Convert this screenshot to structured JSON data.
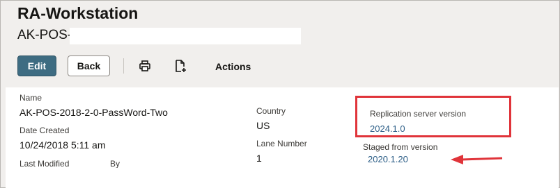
{
  "header": {
    "title": "RA-Workstation",
    "subtitle": "AK-POS-"
  },
  "toolbar": {
    "edit_label": "Edit",
    "back_label": "Back",
    "actions_label": "Actions",
    "icons": [
      "print-icon",
      "new-document-icon"
    ]
  },
  "details": {
    "name_label": "Name",
    "name_value": "AK-POS-2018-2-0-PassWord-Two",
    "date_created_label": "Date Created",
    "date_created_value": "10/24/2018 5:11 am",
    "last_modified_label": "Last Modified",
    "by_label": "By",
    "country_label": "Country",
    "country_value": "US",
    "lane_number_label": "Lane Number",
    "lane_number_value": "1",
    "replication_label": "Replication server version",
    "replication_value": "2024.1.0",
    "staged_label": "Staged from version",
    "staged_value": "2020.1.20"
  },
  "colors": {
    "primary_button": "#3e6c82",
    "highlight_box": "#e0343a",
    "link": "#2b5d86"
  }
}
